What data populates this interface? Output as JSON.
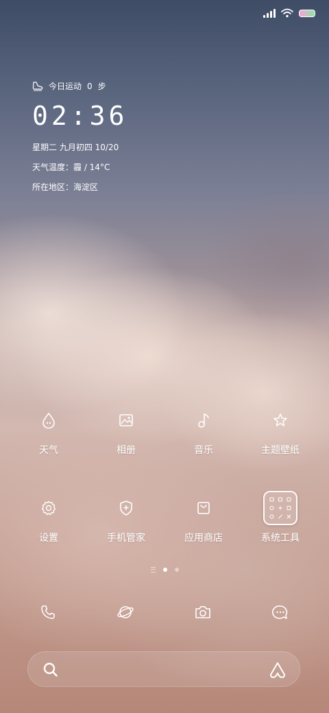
{
  "status_bar": {
    "signal_icon": "signal-icon",
    "wifi_icon": "wifi-icon",
    "battery_icon": "battery-icon"
  },
  "widget": {
    "steps_icon": "sneaker-icon",
    "steps_text": "今日运动",
    "steps_count": "0",
    "steps_unit": "步",
    "time": "02:36",
    "date_line": "星期二  九月初四   10/20",
    "weather_line": "天气温度：霾 / 14°C",
    "location_line": "所在地区：海淀区"
  },
  "apps": [
    {
      "label": "天气",
      "icon": "weather-drop-icon"
    },
    {
      "label": "相册",
      "icon": "gallery-icon"
    },
    {
      "label": "音乐",
      "icon": "music-note-icon"
    },
    {
      "label": "主题壁纸",
      "icon": "theme-star-icon"
    },
    {
      "label": "设置",
      "icon": "settings-gear-icon"
    },
    {
      "label": "手机管家",
      "icon": "security-shield-icon"
    },
    {
      "label": "应用商店",
      "icon": "app-store-bag-icon"
    },
    {
      "label": "系统工具",
      "icon": "system-tools-folder-icon"
    }
  ],
  "pages": {
    "count": 2,
    "active": 1
  },
  "dock": [
    {
      "icon": "phone-icon"
    },
    {
      "icon": "browser-planet-icon"
    },
    {
      "icon": "camera-icon"
    },
    {
      "icon": "messages-icon"
    }
  ],
  "search": {
    "placeholder": "",
    "left_icon": "search-icon",
    "right_icon": "xiaoai-icon"
  }
}
